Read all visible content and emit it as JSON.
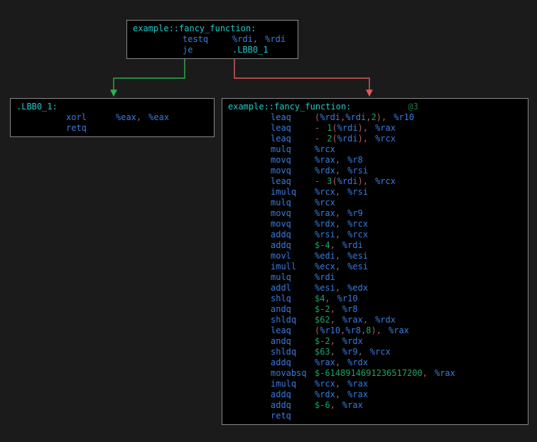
{
  "entry": {
    "label": "example::fancy_function:",
    "rows": [
      {
        "op": "testq",
        "args": [
          [
            "reg",
            "%rdi"
          ],
          [
            "pu",
            ","
          ],
          [
            "sp",
            ""
          ],
          [
            "reg",
            "%rdi"
          ]
        ]
      },
      {
        "op": "je",
        "args": [
          [
            "lbl",
            ".LBB0_1"
          ]
        ]
      }
    ]
  },
  "left": {
    "label": ".LBB0_1:",
    "rows": [
      {
        "op": "xorl",
        "args": [
          [
            "reg",
            "%eax"
          ],
          [
            "pu",
            ","
          ],
          [
            "sp",
            ""
          ],
          [
            "reg",
            "%eax"
          ]
        ]
      },
      {
        "op": "retq",
        "args": []
      }
    ]
  },
  "right": {
    "label": "example::fancy_function:",
    "comment": "@3",
    "rows": [
      {
        "op": "leaq",
        "args": [
          [
            "pu",
            "("
          ],
          [
            "reg",
            "%rdi"
          ],
          [
            "pu",
            ","
          ],
          [
            "reg",
            "%rdi"
          ],
          [
            "pu",
            ","
          ],
          [
            "imm",
            "2"
          ],
          [
            "pu",
            ")"
          ],
          [
            "pu",
            ","
          ],
          [
            "sp",
            ""
          ],
          [
            "reg",
            "%r10"
          ]
        ]
      },
      {
        "op": "leaq",
        "args": [
          [
            "pu",
            "-"
          ],
          [
            "sp",
            ""
          ],
          [
            "imm",
            "1"
          ],
          [
            "pu",
            "("
          ],
          [
            "reg",
            "%rdi"
          ],
          [
            "pu",
            ")"
          ],
          [
            "pu",
            ","
          ],
          [
            "sp",
            ""
          ],
          [
            "reg",
            "%rax"
          ]
        ]
      },
      {
        "op": "leaq",
        "args": [
          [
            "pu",
            "-"
          ],
          [
            "sp",
            ""
          ],
          [
            "imm",
            "2"
          ],
          [
            "pu",
            "("
          ],
          [
            "reg",
            "%rdi"
          ],
          [
            "pu",
            ")"
          ],
          [
            "pu",
            ","
          ],
          [
            "sp",
            ""
          ],
          [
            "reg",
            "%rcx"
          ]
        ]
      },
      {
        "op": "mulq",
        "args": [
          [
            "reg",
            "%rcx"
          ]
        ]
      },
      {
        "op": "movq",
        "args": [
          [
            "reg",
            "%rax"
          ],
          [
            "pu",
            ","
          ],
          [
            "sp",
            ""
          ],
          [
            "reg",
            "%r8"
          ]
        ]
      },
      {
        "op": "movq",
        "args": [
          [
            "reg",
            "%rdx"
          ],
          [
            "pu",
            ","
          ],
          [
            "sp",
            ""
          ],
          [
            "reg",
            "%rsi"
          ]
        ]
      },
      {
        "op": "leaq",
        "args": [
          [
            "pu",
            "-"
          ],
          [
            "sp",
            ""
          ],
          [
            "imm",
            "3"
          ],
          [
            "pu",
            "("
          ],
          [
            "reg",
            "%rdi"
          ],
          [
            "pu",
            ")"
          ],
          [
            "pu",
            ","
          ],
          [
            "sp",
            ""
          ],
          [
            "reg",
            "%rcx"
          ]
        ]
      },
      {
        "op": "imulq",
        "args": [
          [
            "reg",
            "%rcx"
          ],
          [
            "pu",
            ","
          ],
          [
            "sp",
            ""
          ],
          [
            "reg",
            "%rsi"
          ]
        ]
      },
      {
        "op": "mulq",
        "args": [
          [
            "reg",
            "%rcx"
          ]
        ]
      },
      {
        "op": "movq",
        "args": [
          [
            "reg",
            "%rax"
          ],
          [
            "pu",
            ","
          ],
          [
            "sp",
            ""
          ],
          [
            "reg",
            "%r9"
          ]
        ]
      },
      {
        "op": "movq",
        "args": [
          [
            "reg",
            "%rdx"
          ],
          [
            "pu",
            ","
          ],
          [
            "sp",
            ""
          ],
          [
            "reg",
            "%rcx"
          ]
        ]
      },
      {
        "op": "addq",
        "args": [
          [
            "reg",
            "%rsi"
          ],
          [
            "pu",
            ","
          ],
          [
            "sp",
            ""
          ],
          [
            "reg",
            "%rcx"
          ]
        ]
      },
      {
        "op": "addq",
        "args": [
          [
            "imm",
            "$-"
          ],
          [
            "imm",
            "4"
          ],
          [
            "pu",
            ","
          ],
          [
            "sp",
            ""
          ],
          [
            "reg",
            "%rdi"
          ]
        ]
      },
      {
        "op": "movl",
        "args": [
          [
            "reg",
            "%edi"
          ],
          [
            "pu",
            ","
          ],
          [
            "sp",
            ""
          ],
          [
            "reg",
            "%esi"
          ]
        ]
      },
      {
        "op": "imull",
        "args": [
          [
            "reg",
            "%ecx"
          ],
          [
            "pu",
            ","
          ],
          [
            "sp",
            ""
          ],
          [
            "reg",
            "%esi"
          ]
        ]
      },
      {
        "op": "mulq",
        "args": [
          [
            "reg",
            "%rdi"
          ]
        ]
      },
      {
        "op": "addl",
        "args": [
          [
            "reg",
            "%esi"
          ],
          [
            "pu",
            ","
          ],
          [
            "sp",
            ""
          ],
          [
            "reg",
            "%edx"
          ]
        ]
      },
      {
        "op": "shlq",
        "args": [
          [
            "imm",
            "$4"
          ],
          [
            "pu",
            ","
          ],
          [
            "sp",
            ""
          ],
          [
            "reg",
            "%r10"
          ]
        ]
      },
      {
        "op": "andq",
        "args": [
          [
            "imm",
            "$-"
          ],
          [
            "imm",
            "2"
          ],
          [
            "pu",
            ","
          ],
          [
            "sp",
            ""
          ],
          [
            "reg",
            "%r8"
          ]
        ]
      },
      {
        "op": "shldq",
        "args": [
          [
            "imm",
            "$62"
          ],
          [
            "pu",
            ","
          ],
          [
            "sp",
            ""
          ],
          [
            "reg",
            "%rax"
          ],
          [
            "pu",
            ","
          ],
          [
            "sp",
            ""
          ],
          [
            "reg",
            "%rdx"
          ]
        ]
      },
      {
        "op": "leaq",
        "args": [
          [
            "pu",
            "("
          ],
          [
            "reg",
            "%r10"
          ],
          [
            "pu",
            ","
          ],
          [
            "reg",
            "%r8"
          ],
          [
            "pu",
            ","
          ],
          [
            "imm",
            "8"
          ],
          [
            "pu",
            ")"
          ],
          [
            "pu",
            ","
          ],
          [
            "sp",
            ""
          ],
          [
            "reg",
            "%rax"
          ]
        ]
      },
      {
        "op": "andq",
        "args": [
          [
            "imm",
            "$-"
          ],
          [
            "imm",
            "2"
          ],
          [
            "pu",
            ","
          ],
          [
            "sp",
            ""
          ],
          [
            "reg",
            "%rdx"
          ]
        ]
      },
      {
        "op": "shldq",
        "args": [
          [
            "imm",
            "$63"
          ],
          [
            "pu",
            ","
          ],
          [
            "sp",
            ""
          ],
          [
            "reg",
            "%r9"
          ],
          [
            "pu",
            ","
          ],
          [
            "sp",
            ""
          ],
          [
            "reg",
            "%rcx"
          ]
        ]
      },
      {
        "op": "addq",
        "args": [
          [
            "reg",
            "%rax"
          ],
          [
            "pu",
            ","
          ],
          [
            "sp",
            ""
          ],
          [
            "reg",
            "%rdx"
          ]
        ]
      },
      {
        "op": "movabsq",
        "args": [
          [
            "imm",
            "$-"
          ],
          [
            "imm",
            "6148914691236517200"
          ],
          [
            "pu",
            ","
          ],
          [
            "sp",
            ""
          ],
          [
            "reg",
            "%rax"
          ]
        ]
      },
      {
        "op": "imulq",
        "args": [
          [
            "reg",
            "%rcx"
          ],
          [
            "pu",
            ","
          ],
          [
            "sp",
            ""
          ],
          [
            "reg",
            "%rax"
          ]
        ]
      },
      {
        "op": "addq",
        "args": [
          [
            "reg",
            "%rdx"
          ],
          [
            "pu",
            ","
          ],
          [
            "sp",
            ""
          ],
          [
            "reg",
            "%rax"
          ]
        ]
      },
      {
        "op": "addq",
        "args": [
          [
            "imm",
            "$-"
          ],
          [
            "imm",
            "6"
          ],
          [
            "pu",
            ","
          ],
          [
            "sp",
            ""
          ],
          [
            "reg",
            "%rax"
          ]
        ]
      },
      {
        "op": "retq",
        "args": []
      }
    ]
  }
}
